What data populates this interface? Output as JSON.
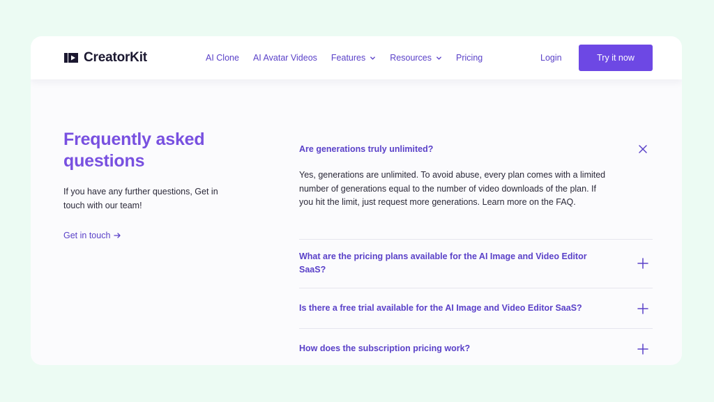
{
  "nav": {
    "brand": "CreatorKit",
    "items": [
      {
        "label": "AI Clone",
        "has_dropdown": false
      },
      {
        "label": "AI Avatar Videos",
        "has_dropdown": false
      },
      {
        "label": "Features",
        "has_dropdown": true
      },
      {
        "label": "Resources",
        "has_dropdown": true
      },
      {
        "label": "Pricing",
        "has_dropdown": false
      }
    ],
    "login": "Login",
    "cta": "Try it now"
  },
  "faq": {
    "title": "Frequently asked questions",
    "subtitle": "If you have any further questions, Get in touch with our team!",
    "link": "Get in touch",
    "items": [
      {
        "question": "Are generations truly unlimited?",
        "expanded": true,
        "answer": "Yes, generations are unlimited. To avoid abuse, every plan comes with a limited number of generations equal to the number of video downloads of the plan. If you hit the limit, just request more generations. Learn more on the FAQ."
      },
      {
        "question": "What are the pricing plans available for the AI Image and Video Editor SaaS?",
        "expanded": false
      },
      {
        "question": "Is there a free trial available for the AI Image and Video Editor SaaS?",
        "expanded": false
      },
      {
        "question": "How does the subscription pricing work?",
        "expanded": false
      }
    ]
  },
  "colors": {
    "background": "#ecfbf3",
    "accent": "#6d48e4",
    "heading": "#7850e0",
    "link": "#5a41c8",
    "text": "#2a2838"
  },
  "icons": {
    "brand": "play-logo-icon",
    "dropdown": "chevron-down-icon",
    "link_arrow": "arrow-right-icon",
    "expanded": "close-icon",
    "collapsed": "plus-icon"
  }
}
